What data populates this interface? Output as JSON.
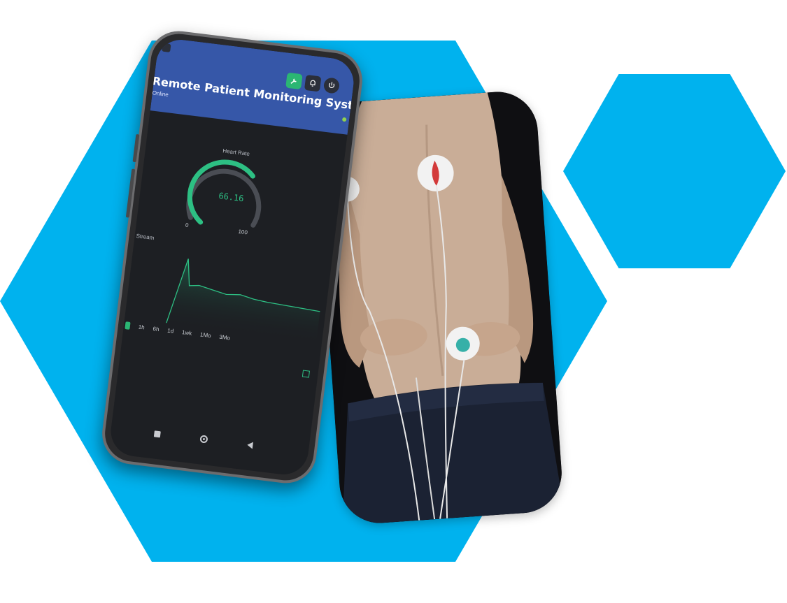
{
  "app": {
    "title": "Remote Patient Monitoring System",
    "status": "Online"
  },
  "header_icons": [
    "wrench-icon",
    "bell-icon",
    "power-icon"
  ],
  "gauge": {
    "label": "Heart Rate",
    "value": "66.16",
    "min_label": "0",
    "max_label": "100",
    "value_number": 66.16,
    "range": [
      0,
      100
    ],
    "color": "#2dbf83"
  },
  "stream": {
    "label": "Stream"
  },
  "time_ranges": [
    "1h",
    "6h",
    "1d",
    "1wk",
    "1Mo",
    "3Mo"
  ],
  "nav_icons": [
    "square-icon",
    "circle-icon",
    "back-triangle-icon"
  ],
  "colors": {
    "accent_blue": "#00b2ee",
    "header_blue": "#3657a8",
    "gauge_green": "#2dbf83",
    "screen_bg": "#1d1f23"
  }
}
